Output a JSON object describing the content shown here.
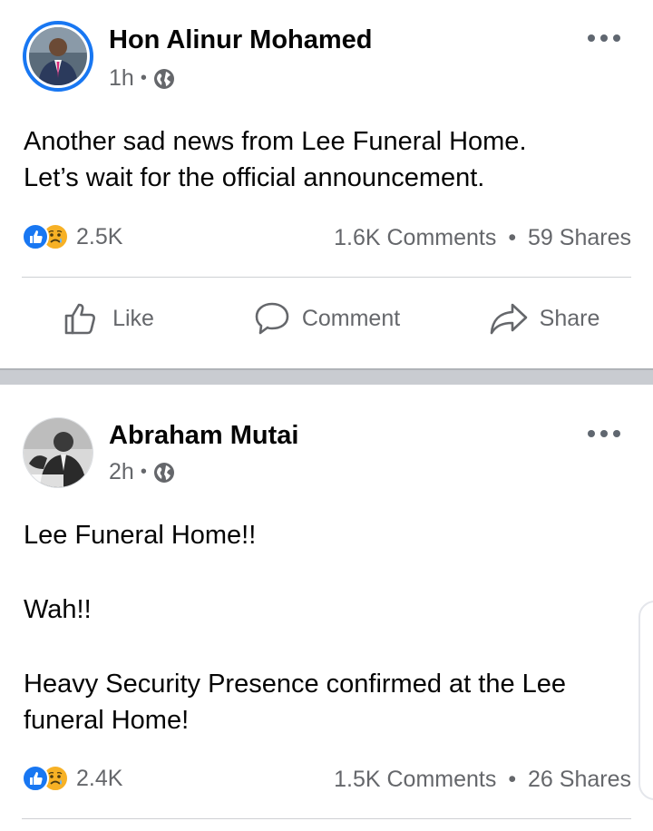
{
  "posts": [
    {
      "author": "Hon Alinur Mohamed",
      "time": "1h",
      "separator": "•",
      "audience_icon": "globe-icon",
      "text_lines": [
        "Another sad news from Lee Funeral Home.",
        "Let’s wait for the official announcement."
      ],
      "reaction_icons": [
        "like-icon",
        "sad-icon"
      ],
      "reaction_count": "2.5K",
      "comments": "1.6K Comments",
      "shares": "59 Shares",
      "actions": {
        "like": "Like",
        "comment": "Comment",
        "share": "Share"
      }
    },
    {
      "author": "Abraham Mutai",
      "time": "2h",
      "separator": "•",
      "audience_icon": "globe-icon",
      "paragraphs": [
        "Lee Funeral Home!!",
        "Wah!!",
        "Heavy Security Presence confirmed at the Lee",
        "funeral Home!"
      ],
      "reaction_icons": [
        "like-icon",
        "sad-icon"
      ],
      "reaction_count": "2.4K",
      "comments": "1.5K Comments",
      "shares": "26 Shares"
    }
  ],
  "counts_separator": "•",
  "colors": {
    "accent": "#1877f2",
    "sad": "#f7b125",
    "secondary_text": "#65676b",
    "separator_band": "#c9ccd1"
  }
}
